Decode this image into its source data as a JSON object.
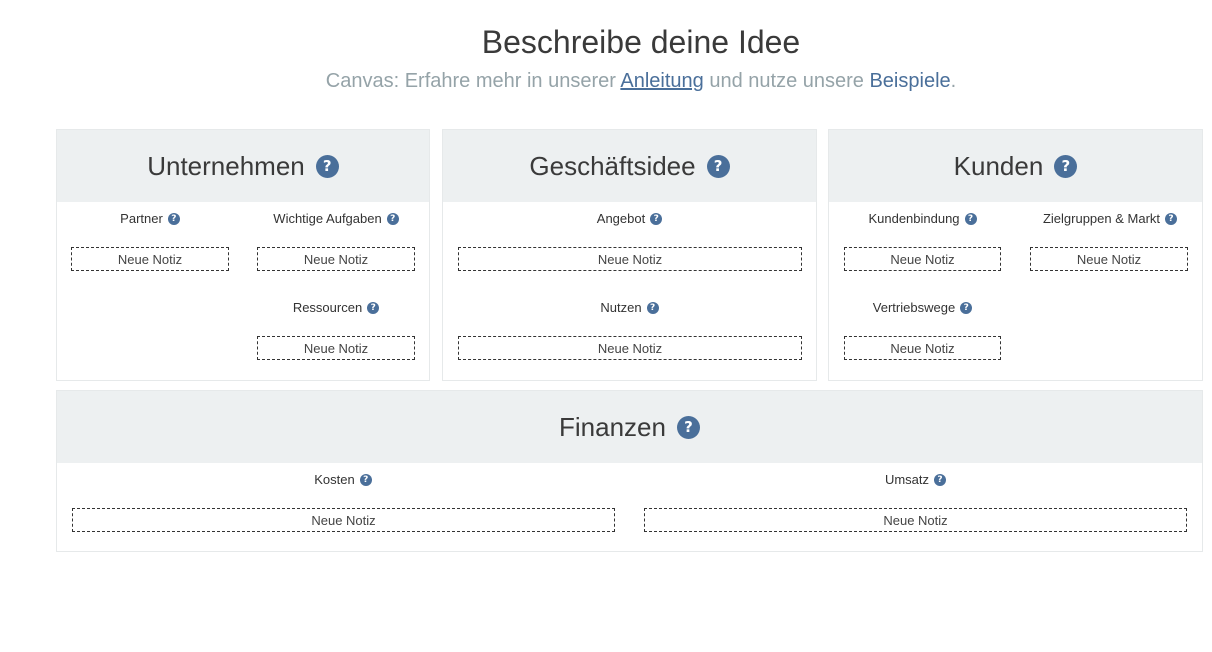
{
  "header": {
    "title": "Beschreibe deine Idee",
    "subtitle_prefix": "Canvas: Erfahre mehr in unserer ",
    "guide_link": "Anleitung",
    "subtitle_middle": " und nutze unsere ",
    "examples_link": "Beispiele",
    "subtitle_suffix": "."
  },
  "help_glyph": "?",
  "note_label": "Neue Notiz",
  "panels": {
    "unternehmen": {
      "title": "Unternehmen",
      "sections": {
        "partner": "Partner",
        "aufgaben": "Wichtige Aufgaben",
        "ressourcen": "Ressourcen"
      }
    },
    "geschaeftsidee": {
      "title": "Geschäftsidee",
      "sections": {
        "angebot": "Angebot",
        "nutzen": "Nutzen"
      }
    },
    "kunden": {
      "title": "Kunden",
      "sections": {
        "kundenbindung": "Kundenbindung",
        "zielgruppen": "Zielgruppen & Markt",
        "vertriebswege": "Vertriebswege"
      }
    },
    "finanzen": {
      "title": "Finanzen",
      "sections": {
        "kosten": "Kosten",
        "umsatz": "Umsatz"
      }
    }
  },
  "colors": {
    "accent": "#4a6f9a",
    "panel_header_bg": "#edf0f1",
    "subtitle": "#95a3a8"
  }
}
